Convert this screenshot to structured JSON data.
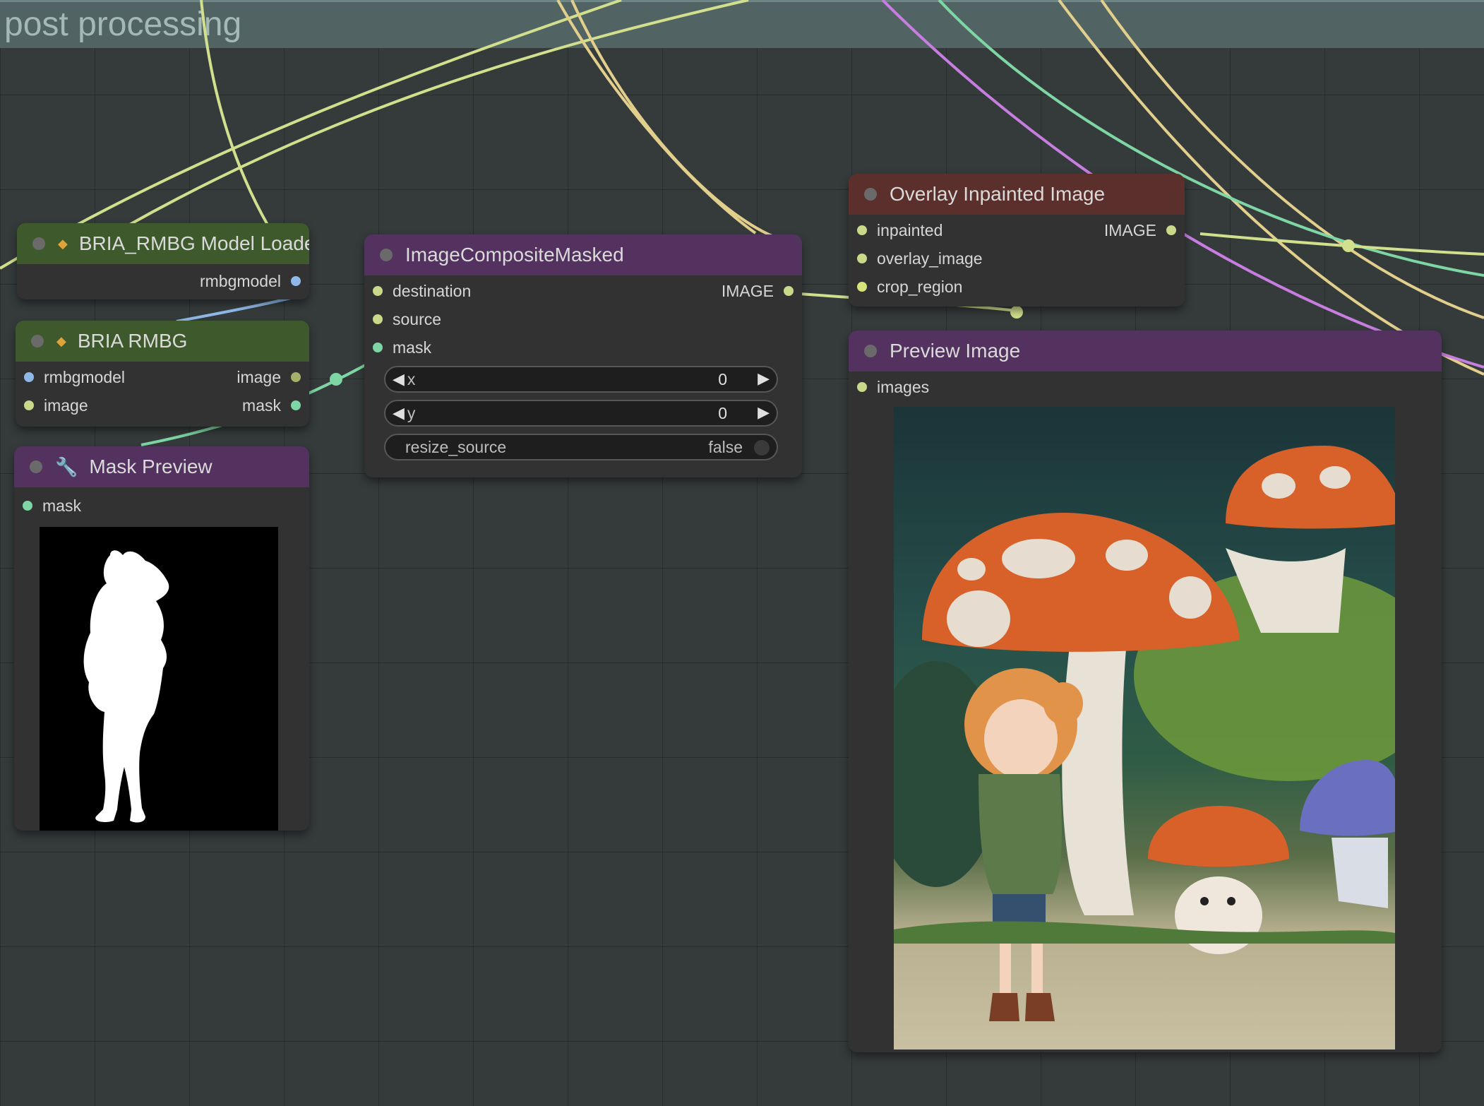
{
  "group": {
    "title": "post processing"
  },
  "nodes": {
    "model_loader": {
      "title": "BRIA_RMBG Model Loader",
      "outputs": [
        "rmbgmodel"
      ]
    },
    "rmbg": {
      "title": "BRIA RMBG",
      "inputs": [
        "rmbgmodel",
        "image"
      ],
      "outputs": [
        "image",
        "mask"
      ]
    },
    "mask_preview": {
      "title": "Mask Preview",
      "inputs": [
        "mask"
      ]
    },
    "composite": {
      "title": "ImageCompositeMasked",
      "inputs": [
        "destination",
        "source",
        "mask"
      ],
      "outputs": [
        "IMAGE"
      ],
      "widgets": {
        "x": {
          "label": "x",
          "value": "0"
        },
        "y": {
          "label": "y",
          "value": "0"
        },
        "resize_source": {
          "label": "resize_source",
          "value": "false"
        }
      }
    },
    "overlay": {
      "title": "Overlay Inpainted Image",
      "inputs": [
        "inpainted",
        "overlay_image",
        "crop_region"
      ],
      "outputs": [
        "IMAGE"
      ]
    },
    "preview": {
      "title": "Preview Image",
      "inputs": [
        "images"
      ]
    }
  },
  "colors": {
    "image_slot": "#c8d98a",
    "model_slot": "#8fb8e8",
    "mask_slot": "#7fd6a5",
    "wire_image": "#d2e08e",
    "wire_mask": "#7fd6a5",
    "wire_pink": "#c77ee0",
    "wire_yellow": "#e2cf8c"
  },
  "icons": {
    "node_dot": "circle-dot-icon",
    "custom_node": "custom-node-icon",
    "tool": "wrench-icon"
  }
}
